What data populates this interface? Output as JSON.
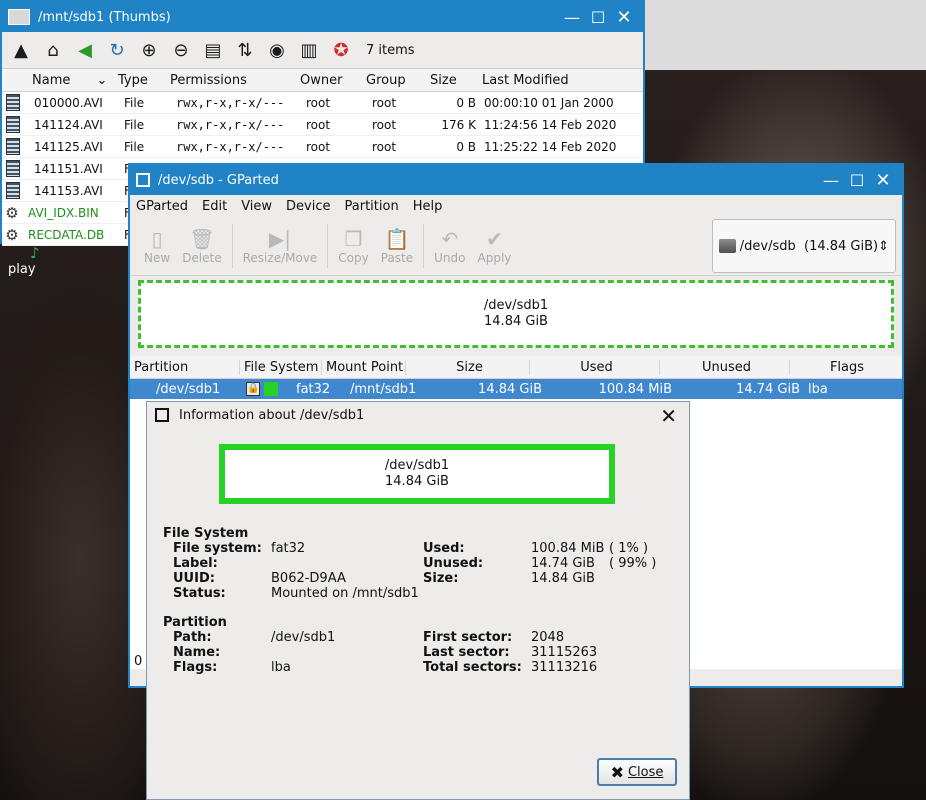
{
  "desktop": {
    "label": "play"
  },
  "file_manager": {
    "title": "/mnt/sdb1 (Thumbs)",
    "items_count": "7 items",
    "columns": [
      "Name",
      "Type",
      "Permissions",
      "Owner",
      "Group",
      "Size",
      "Last Modified"
    ],
    "rows": [
      {
        "name": "010000.AVI",
        "type": "File",
        "perm": "rwx,r-x,r-x/---",
        "owner": "root",
        "group": "root",
        "size": "0 B",
        "modified": "00:00:10 01 Jan 2000"
      },
      {
        "name": "141124.AVI",
        "type": "File",
        "perm": "rwx,r-x,r-x/---",
        "owner": "root",
        "group": "root",
        "size": "176 K",
        "modified": "11:24:56 14 Feb 2020"
      },
      {
        "name": "141125.AVI",
        "type": "File",
        "perm": "rwx,r-x,r-x/---",
        "owner": "root",
        "group": "root",
        "size": "0 B",
        "modified": "11:25:22 14 Feb 2020"
      },
      {
        "name": "141151.AVI",
        "type": "Fi"
      },
      {
        "name": "141153.AVI",
        "type": "F"
      },
      {
        "name": "AVI_IDX.BIN",
        "type": "F"
      },
      {
        "name": "RECDATA.DB",
        "type": "F"
      }
    ]
  },
  "gparted": {
    "title": "/dev/sdb - GParted",
    "menu": [
      "GParted",
      "Edit",
      "View",
      "Device",
      "Partition",
      "Help"
    ],
    "toolbar": [
      "New",
      "Delete",
      "Resize/Move",
      "Copy",
      "Paste",
      "Undo",
      "Apply"
    ],
    "device": "/dev/sdb  (14.84 GiB)",
    "map": {
      "name": "/dev/sdb1",
      "size": "14.84 GiB"
    },
    "columns": [
      "Partition",
      "File System",
      "Mount Point",
      "Size",
      "Used",
      "Unused",
      "Flags"
    ],
    "row": {
      "partition": "/dev/sdb1",
      "fs": "fat32",
      "mount": "/mnt/sdb1",
      "size": "14.84 GiB",
      "used": "100.84 MiB",
      "unused": "14.74 GiB",
      "flags": "lba"
    },
    "status_fragment": "0"
  },
  "info": {
    "title": "Information about /dev/sdb1",
    "box": {
      "name": "/dev/sdb1",
      "size": "14.84 GiB"
    },
    "fs_section": "File System",
    "fs": {
      "fs_label": "File system:",
      "fs": "fat32",
      "label_label": "Label:",
      "label": "",
      "uuid_label": "UUID:",
      "uuid": "B062-D9AA",
      "status_label": "Status:",
      "status": "Mounted on /mnt/sdb1",
      "used_label": "Used:",
      "used": "100.84 MiB",
      "used_pct": "( 1% )",
      "unused_label": "Unused:",
      "unused": "14.74 GiB",
      "unused_pct": "( 99% )",
      "size_label": "Size:",
      "size": "14.84 GiB"
    },
    "part_section": "Partition",
    "part": {
      "path_label": "Path:",
      "path": "/dev/sdb1",
      "name_label": "Name:",
      "name": "",
      "flags_label": "Flags:",
      "flags": "lba",
      "first_label": "First sector:",
      "first": "2048",
      "last_label": "Last sector:",
      "last": "31115263",
      "total_label": "Total sectors:",
      "total": "31113216"
    },
    "close_label": "Close"
  }
}
